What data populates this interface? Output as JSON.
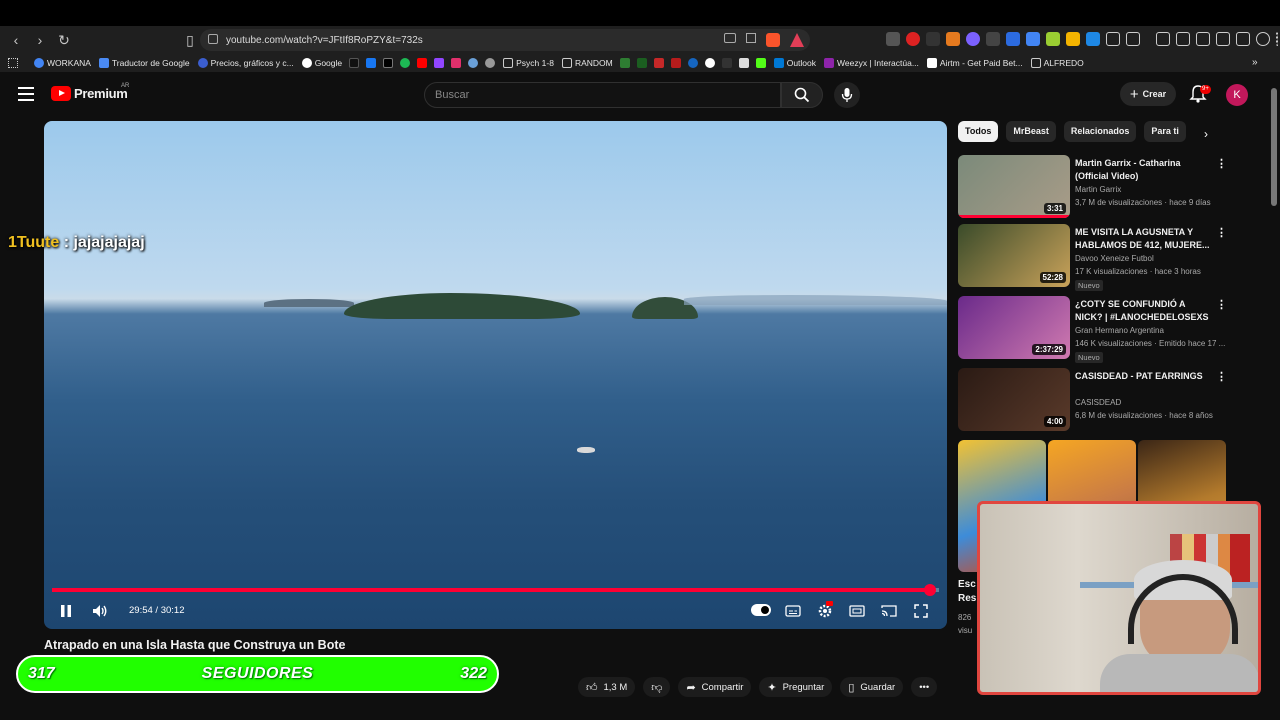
{
  "browser": {
    "url": "youtube.com/watch?v=JFtIf8RoPZY&t=732s",
    "bookmarks": [
      "WORKANA",
      "Traductor de Google",
      "Precios, gráficos y c...",
      "Google",
      "Psych 1-8",
      "RANDOM",
      "Outlook",
      "Weezyx | Interactúa...",
      "Airtm - Get Paid Bet...",
      "ALFREDO"
    ]
  },
  "header": {
    "logo": "Premium",
    "logo_country": "AR",
    "search_placeholder": "Buscar",
    "create_label": "Crear",
    "notifications_badge": "9+",
    "avatar_initial": "K"
  },
  "player": {
    "overlay_user": "1Tuute",
    "overlay_message": " : jajajajajaj",
    "time_current": "29:54",
    "time_separator": " / ",
    "time_total": "30:12",
    "progress_fraction": 0.99
  },
  "video": {
    "title": "Atrapado en una Isla Hasta que Construya un Bote",
    "likes": "1,3 M",
    "share_label": "Compartir",
    "ask_label": "Preguntar",
    "save_label": "Guardar"
  },
  "followers_bar": {
    "current": "317",
    "label": "SEGUIDORES",
    "goal": "322"
  },
  "sidebar": {
    "chips": [
      "Todos",
      "MrBeast",
      "Relacionados",
      "Para ti"
    ],
    "recommendations": [
      {
        "title": "Martin Garrix - Catharina (Official Video)",
        "channel": "Martin Garrix",
        "meta": "3,7 M de visualizaciones · hace 9 días",
        "duration": "3:31",
        "badge": "",
        "watched": 1.0,
        "colors": [
          "#7b8a7a",
          "#a99c88"
        ]
      },
      {
        "title": "ME VISITA LA AGUSNETA Y HABLAMOS DE 412, MUJERE...",
        "channel": "Davoo Xeneize Futbol",
        "meta": "17 K visualizaciones · hace 3 horas",
        "duration": "52:28",
        "badge": "Nuevo",
        "watched": 0,
        "colors": [
          "#3a4b2a",
          "#c9a25a"
        ]
      },
      {
        "title": "¿COTY SE CONFUNDIÓ A NICK? | #LANOCHEDELOSEXS ...",
        "channel": "Gran Hermano Argentina",
        "meta": "146 K visualizaciones · Emitido hace 17 ...",
        "duration": "2:37:29",
        "badge": "Nuevo",
        "watched": 0,
        "colors": [
          "#6a2a8a",
          "#d07ab0"
        ]
      },
      {
        "title": "CASISDEAD - PAT EARRINGS",
        "channel": "CASISDEAD",
        "meta": "6,8 M de visualizaciones · hace 8 años",
        "duration": "4:00",
        "badge": "",
        "watched": 0,
        "colors": [
          "#2a1a14",
          "#5a3a2a"
        ]
      }
    ],
    "shorts_fragment_title": "Esc\nRes",
    "shorts_fragment_meta": "826\nvisu"
  }
}
